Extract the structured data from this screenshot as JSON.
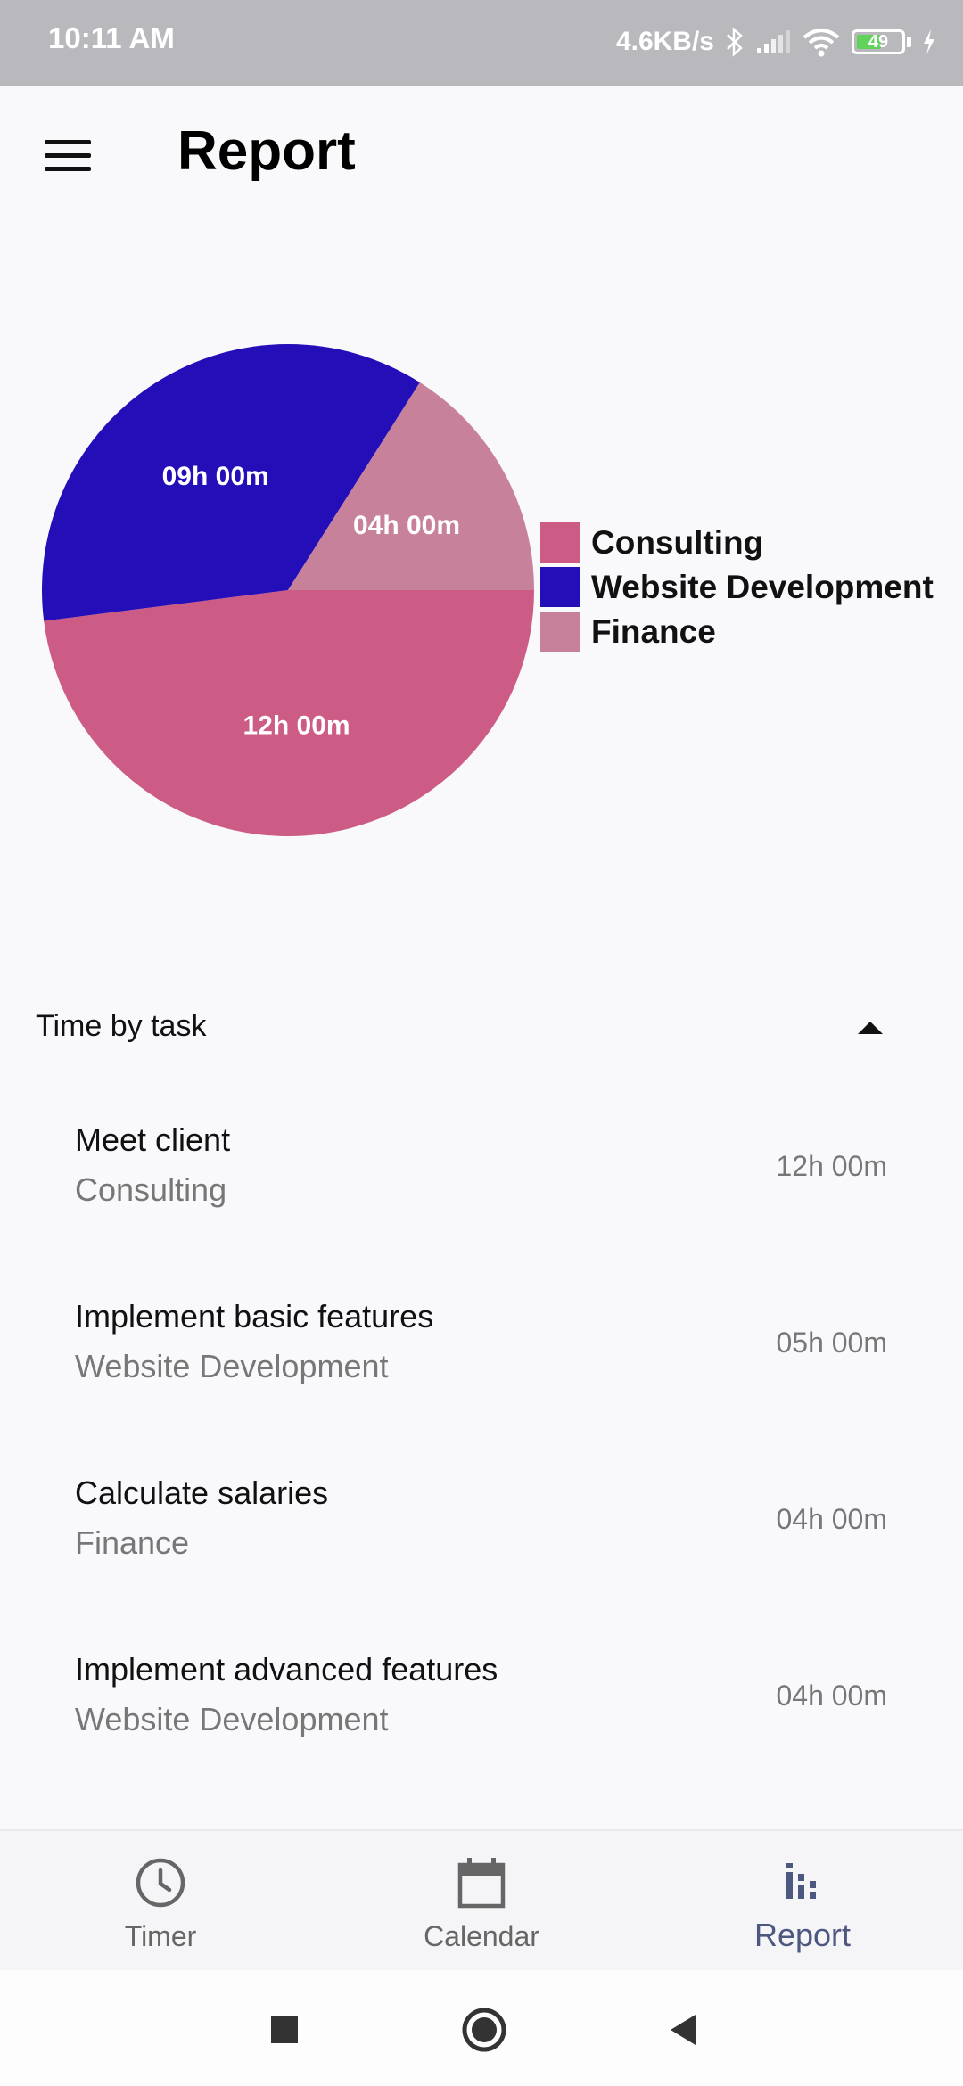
{
  "status_bar": {
    "time": "10:11 AM",
    "net_speed": "4.6KB/s",
    "battery": "49",
    "icons": [
      "bluetooth-icon",
      "signal-icon",
      "wifi-icon",
      "battery-icon",
      "charging-icon"
    ]
  },
  "header": {
    "title": "Report",
    "menu_icon": "menu-icon"
  },
  "chart_data": {
    "type": "pie",
    "slices": [
      {
        "name": "Consulting",
        "value": 12,
        "label": "12h 00m",
        "color": "#cc5b86"
      },
      {
        "name": "Website Development",
        "value": 9,
        "label": "09h 00m",
        "color": "#240eb8"
      },
      {
        "name": "Finance",
        "value": 4,
        "label": "04h 00m",
        "color": "#c8819a"
      }
    ],
    "legend": [
      "Consulting",
      "Website Development",
      "Finance"
    ],
    "legend_position": "right"
  },
  "section": {
    "title": "Time by task",
    "expanded": true
  },
  "tasks": [
    {
      "name": "Meet client",
      "project": "Consulting",
      "duration": "12h 00m"
    },
    {
      "name": "Implement basic features",
      "project": "Website Development",
      "duration": "05h 00m"
    },
    {
      "name": "Calculate salaries",
      "project": "Finance",
      "duration": "04h 00m"
    },
    {
      "name": "Implement advanced features",
      "project": "Website Development",
      "duration": "04h 00m"
    }
  ],
  "bottom_nav": {
    "items": [
      {
        "label": "Timer",
        "icon": "clock-icon",
        "active": false
      },
      {
        "label": "Calendar",
        "icon": "calendar-icon",
        "active": false
      },
      {
        "label": "Report",
        "icon": "bar-chart-icon",
        "active": true
      }
    ],
    "active_color": "#4c5880"
  },
  "system_nav": {
    "icons": [
      "recents-icon",
      "home-icon",
      "back-icon"
    ]
  }
}
